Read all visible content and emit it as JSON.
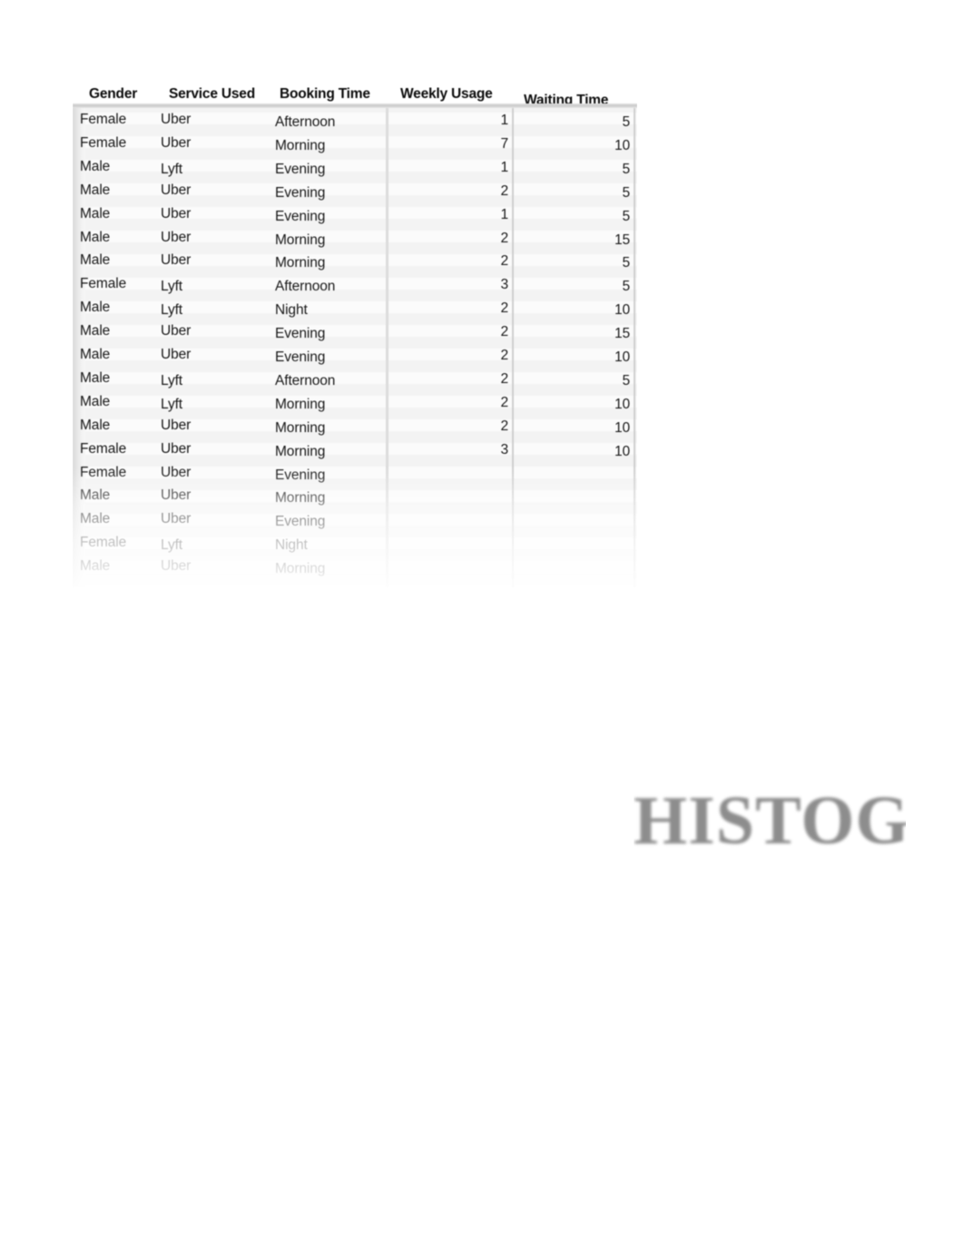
{
  "document": {
    "background_color": "#ffffff"
  },
  "table": {
    "name": "ride-service-survey-table",
    "columns": [
      {
        "key": "gender",
        "label": "Gender",
        "align": "left"
      },
      {
        "key": "service",
        "label": "Service Used",
        "align": "left"
      },
      {
        "key": "booking",
        "label": "Booking Time",
        "align": "left"
      },
      {
        "key": "weekly",
        "label": "Weekly Usage",
        "align": "right"
      },
      {
        "key": "waiting",
        "label": "Waiting Time",
        "align": "right"
      }
    ],
    "rows": [
      {
        "gender": "Female",
        "service": "Uber",
        "booking": "Afternoon",
        "weekly": "1",
        "waiting": "5"
      },
      {
        "gender": "Female",
        "service": "Uber",
        "booking": "Morning",
        "weekly": "7",
        "waiting": "10"
      },
      {
        "gender": "Male",
        "service": "Lyft",
        "booking": "Evening",
        "weekly": "1",
        "waiting": "5"
      },
      {
        "gender": "Male",
        "service": "Uber",
        "booking": "Evening",
        "weekly": "2",
        "waiting": "5"
      },
      {
        "gender": "Male",
        "service": "Uber",
        "booking": "Evening",
        "weekly": "1",
        "waiting": "5"
      },
      {
        "gender": "Male",
        "service": "Uber",
        "booking": "Morning",
        "weekly": "2",
        "waiting": "15"
      },
      {
        "gender": "Male",
        "service": "Uber",
        "booking": "Morning",
        "weekly": "2",
        "waiting": "5"
      },
      {
        "gender": "Female",
        "service": "Lyft",
        "booking": "Afternoon",
        "weekly": "3",
        "waiting": "5"
      },
      {
        "gender": "Male",
        "service": "Lyft",
        "booking": "Night",
        "weekly": "2",
        "waiting": "10"
      },
      {
        "gender": "Male",
        "service": "Uber",
        "booking": "Evening",
        "weekly": "2",
        "waiting": "15"
      },
      {
        "gender": "Male",
        "service": "Uber",
        "booking": "Evening",
        "weekly": "2",
        "waiting": "10"
      },
      {
        "gender": "Male",
        "service": "Lyft",
        "booking": "Afternoon",
        "weekly": "2",
        "waiting": "5"
      },
      {
        "gender": "Male",
        "service": "Lyft",
        "booking": "Morning",
        "weekly": "2",
        "waiting": "10"
      },
      {
        "gender": "Male",
        "service": "Uber",
        "booking": "Morning",
        "weekly": "2",
        "waiting": "10"
      },
      {
        "gender": "Female",
        "service": "Uber",
        "booking": "Morning",
        "weekly": "3",
        "waiting": "10"
      },
      {
        "gender": "Female",
        "service": "Uber",
        "booking": "Evening",
        "weekly": "",
        "waiting": ""
      },
      {
        "gender": "Male",
        "service": "Uber",
        "booking": "Morning",
        "weekly": "",
        "waiting": ""
      },
      {
        "gender": "Male",
        "service": "Uber",
        "booking": "Evening",
        "weekly": "",
        "waiting": ""
      },
      {
        "gender": "Female",
        "service": "Lyft",
        "booking": "Night",
        "weekly": "",
        "waiting": ""
      },
      {
        "gender": "Male",
        "service": "Uber",
        "booking": "Morning",
        "weekly": "",
        "waiting": ""
      }
    ]
  },
  "wordart": {
    "text": "HISTOG",
    "color": "#8d8d8d"
  }
}
